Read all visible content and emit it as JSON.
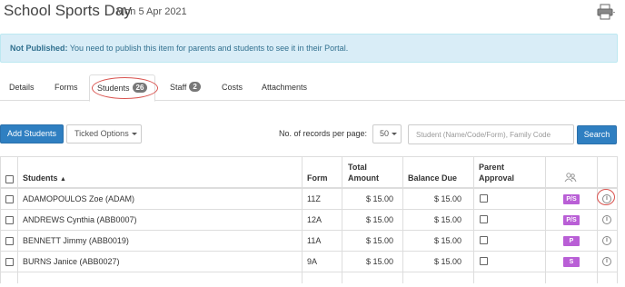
{
  "header": {
    "title": "School Sports Day",
    "date": "Mon 5 Apr 2021"
  },
  "alert": {
    "label": "Not Published:",
    "message": " You need to publish this item for parents and students to see it in their Portal."
  },
  "tabs": [
    {
      "label": "Details"
    },
    {
      "label": "Forms"
    },
    {
      "label": "Students",
      "badge": "26"
    },
    {
      "label": "Staff",
      "badge": "2"
    },
    {
      "label": "Costs"
    },
    {
      "label": "Attachments"
    }
  ],
  "toolbar": {
    "add_students": "Add Students",
    "ticked_options": "Ticked Options",
    "records_label": "No. of records per page:",
    "records_value": "50",
    "search_placeholder": "Student (Name/Code/Form), Family Code",
    "search_button": "Search"
  },
  "table": {
    "headers": {
      "students": "Students",
      "form": "Form",
      "total_line1": "Total",
      "total_line2": "Amount",
      "balance": "Balance Due",
      "parent_line1": "Parent",
      "parent_line2": "Approval"
    },
    "rows": [
      {
        "name": "ADAMOPOULOS Zoe (ADAM)",
        "form": "11Z",
        "total": "$ 15.00",
        "balance": "$ 15.00",
        "tag": "P/S"
      },
      {
        "name": "ANDREWS Cynthia (ABB0007)",
        "form": "12A",
        "total": "$ 15.00",
        "balance": "$ 15.00",
        "tag": "P/S"
      },
      {
        "name": "BENNETT Jimmy (ABB0019)",
        "form": "11A",
        "total": "$ 15.00",
        "balance": "$ 15.00",
        "tag": "P"
      },
      {
        "name": "BURNS Janice (ABB0027)",
        "form": "9A",
        "total": "$ 15.00",
        "balance": "$ 15.00",
        "tag": "S"
      }
    ]
  },
  "icons": {
    "printer": "printer-icon",
    "people": "people-icon",
    "sort": "sort-up-icon",
    "info": "info-icon"
  },
  "colors": {
    "primary": "#2f7fc1",
    "alert_bg": "#d9edf7",
    "alert_text": "#31708f",
    "tag": "#b95fd6",
    "highlight": "#d9534f"
  }
}
